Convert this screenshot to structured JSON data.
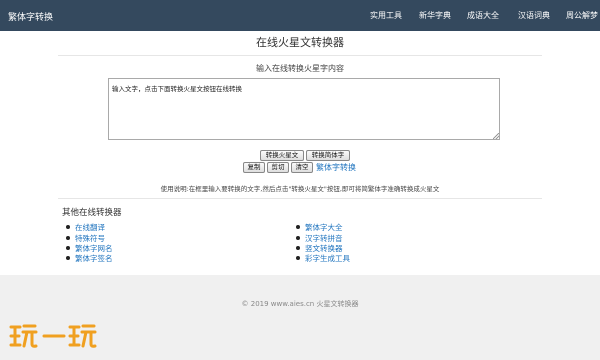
{
  "header": {
    "brand": "繁体字转换",
    "nav": [
      "实用工具",
      "新华字典",
      "成语大全",
      "汉语词典",
      "周公解梦"
    ]
  },
  "main": {
    "title": "在线火星文转换器",
    "input_label": "输入在线转换火星字内容",
    "textarea_value": "输入文字，点击下面转换火星文按钮在线转换",
    "buttons": {
      "convert_mars": "转换火星文",
      "convert_simplified": "转换简体字",
      "copy": "复制",
      "cut": "剪切",
      "clear": "清空"
    },
    "traditional_link": "繁体字转换",
    "usage": "使用说明:在框里输入要转换的文字,然后点击\"转换火星文\"按钮,即可将简繁体字准确转换成火星文"
  },
  "others": {
    "title": "其他在线转换器",
    "left": [
      "在线翻译",
      "特殊符号",
      "繁体字网名",
      "繁体字签名"
    ],
    "right": [
      "繁体字大全",
      "汉字转拼音",
      "竖文转换器",
      "彩字生成工具"
    ]
  },
  "footer": {
    "copyright": "© 2019 www.aies.cn 火星文转换器"
  },
  "watermark": {
    "text": "玩一玩"
  },
  "colors": {
    "navbar": "#34495e",
    "link": "#1e73be",
    "footer_bg": "#f0f0f0",
    "watermark": "#f0a020"
  }
}
